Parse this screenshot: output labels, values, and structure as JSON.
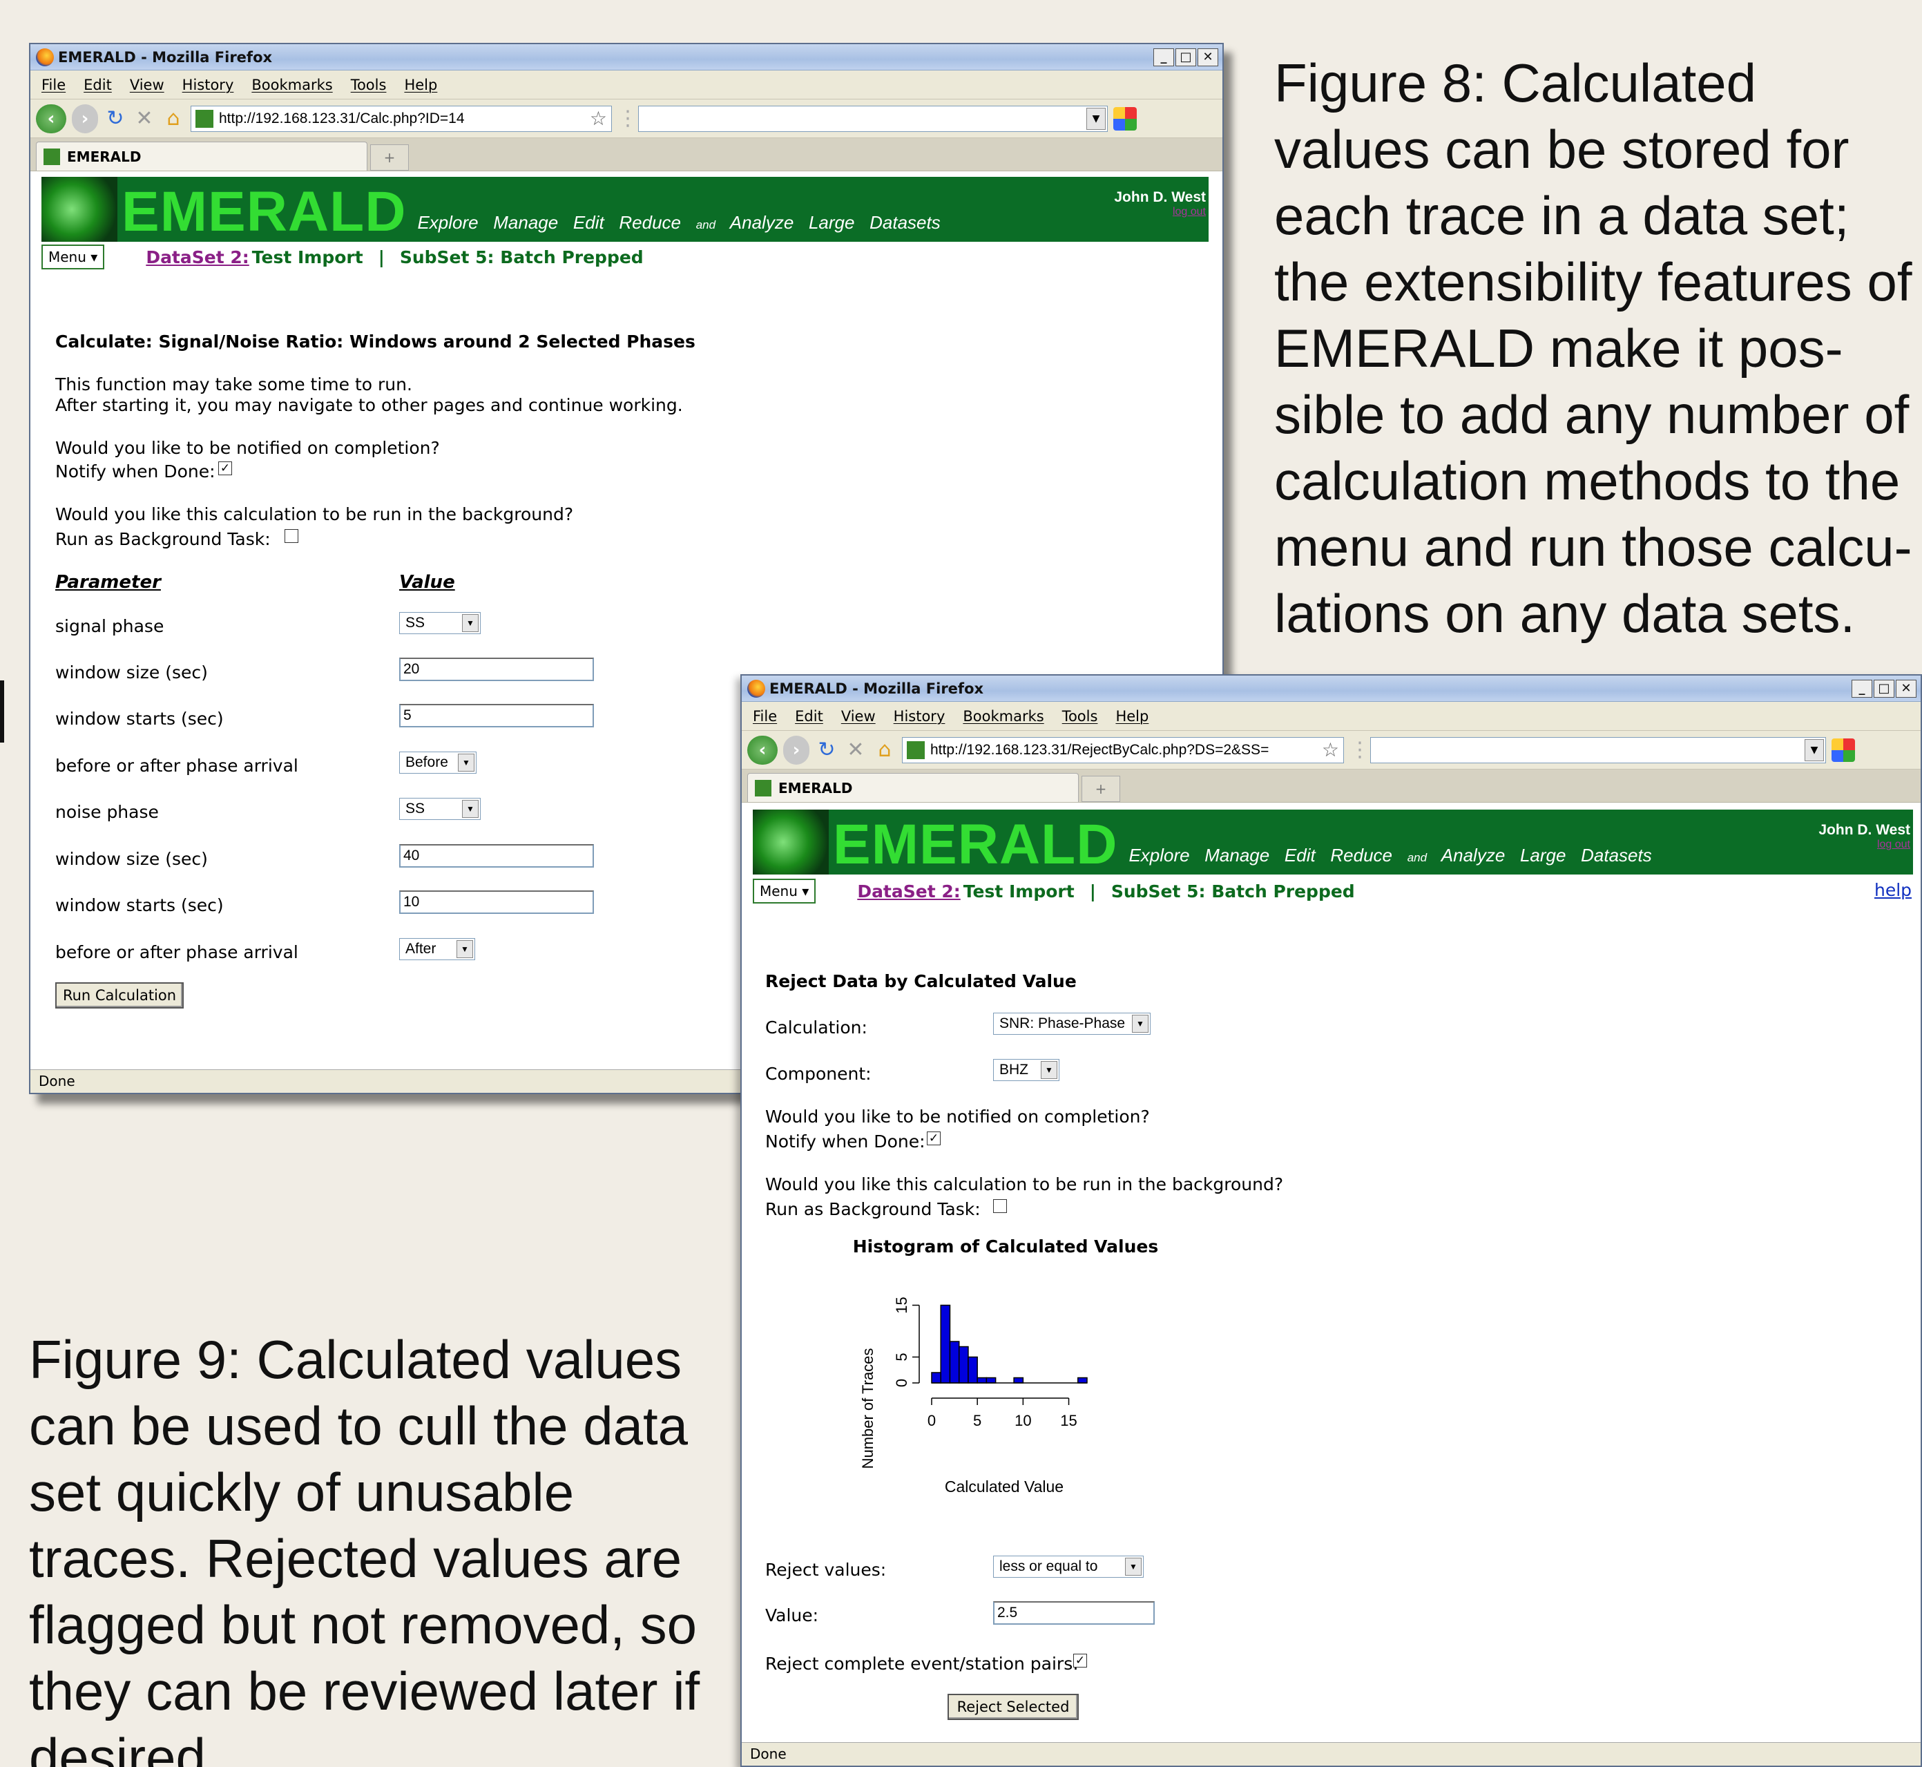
{
  "captions": {
    "figure8": [
      "Figure 8:  Calculated",
      "values can be stored for",
      "each trace in a data set;",
      "the extensibility features of",
      "EMERALD make it pos-",
      "sible to add any number of",
      "calculation methods to the",
      "menu and run those calcu-",
      "lations on any data sets."
    ],
    "figure9": [
      "Figure 9:  Calculated values",
      "can be used to cull the data",
      "set quickly of unusable",
      "traces.  Rejected values are",
      "flagged but not removed, so",
      "they can be reviewed later if",
      "desired."
    ]
  },
  "browser": {
    "window_title": "EMERALD - Mozilla Firefox",
    "menu": [
      "File",
      "Edit",
      "View",
      "History",
      "Bookmarks",
      "Tools",
      "Help"
    ],
    "tab_label": "EMERALD",
    "status": "Done"
  },
  "banner": {
    "title": "EMERALD",
    "tagline_words": [
      "Explore",
      "Manage",
      "Edit",
      "Reduce",
      "and",
      "Analyze",
      "Large",
      "Datasets"
    ],
    "user": "John D. West",
    "logout": "log out"
  },
  "subnav": {
    "menu_label": "Menu ▾",
    "dataset_link": "DataSet 2:",
    "dataset_name": "Test Import",
    "separator": "|",
    "subset": "SubSet 5: Batch Prepped"
  },
  "window1": {
    "url": "http://192.168.123.31/Calc.php?ID=14",
    "heading": "Calculate: Signal/Noise Ratio: Windows around 2 Selected Phases",
    "intro_line1": "This function may take some time to run.",
    "intro_line2": "After starting it, you may navigate to other pages and continue working.",
    "notify_question": "Would you like to be notified on completion?",
    "notify_label": "Notify when Done:",
    "notify_checked": true,
    "background_question": "Would you like this calculation to be run in the background?",
    "background_label": "Run as Background Task:",
    "background_checked": false,
    "param_header": "Parameter",
    "value_header": "Value",
    "params": [
      {
        "label": "signal phase",
        "kind": "select",
        "value": "SS"
      },
      {
        "label": "window size (sec)",
        "kind": "input",
        "value": "20"
      },
      {
        "label": "window starts (sec)",
        "kind": "input",
        "value": "5"
      },
      {
        "label": "before or after phase arrival",
        "kind": "select",
        "value": "Before"
      },
      {
        "label": "noise phase",
        "kind": "select",
        "value": "SS"
      },
      {
        "label": "window size (sec)",
        "kind": "input",
        "value": "40"
      },
      {
        "label": "window starts (sec)",
        "kind": "input",
        "value": "10"
      },
      {
        "label": "before or after phase arrival",
        "kind": "select",
        "value": "After"
      }
    ],
    "run_button": "Run Calculation"
  },
  "window2": {
    "url": "http://192.168.123.31/RejectByCalc.php?DS=2&SS=",
    "help": "help",
    "heading": "Reject Data by Calculated Value",
    "calculation_label": "Calculation:",
    "calculation_value": "SNR: Phase-Phase",
    "component_label": "Component:",
    "component_value": "BHZ",
    "notify_question": "Would you like to be notified on completion?",
    "notify_label": "Notify when Done:",
    "notify_checked": true,
    "background_question": "Would you like this calculation to be run in the background?",
    "background_label": "Run as Background Task:",
    "background_checked": false,
    "reject_values_label": "Reject values:",
    "reject_values_value": "less or equal to",
    "value_label": "Value:",
    "value_value": "2.5",
    "pairs_label": "Reject complete event/station pairs:",
    "pairs_checked": true,
    "reject_button": "Reject Selected"
  },
  "chart_data": {
    "type": "bar",
    "title": "Histogram of Calculated Values",
    "xlabel": "Calculated Value",
    "ylabel": "Number of Traces",
    "xticks": [
      0,
      5,
      10,
      15
    ],
    "yticks": [
      0,
      5,
      15
    ],
    "xlim": [
      0,
      17
    ],
    "ylim": [
      0,
      16
    ],
    "bin_width": 1,
    "bins": [
      0,
      1,
      2,
      3,
      4,
      5,
      6,
      7,
      8,
      9,
      10,
      11,
      12,
      13,
      14,
      15,
      16
    ],
    "values": [
      2,
      15,
      8,
      7,
      5,
      1,
      1,
      0,
      0,
      1,
      0,
      0,
      0,
      0,
      0,
      0,
      1
    ],
    "bar_color": "#0000dd"
  },
  "colors": {
    "banner": "#0b6d26",
    "banner_title": "#33dd33",
    "link": "#8a1f86",
    "green_text": "#0c6a1e"
  }
}
